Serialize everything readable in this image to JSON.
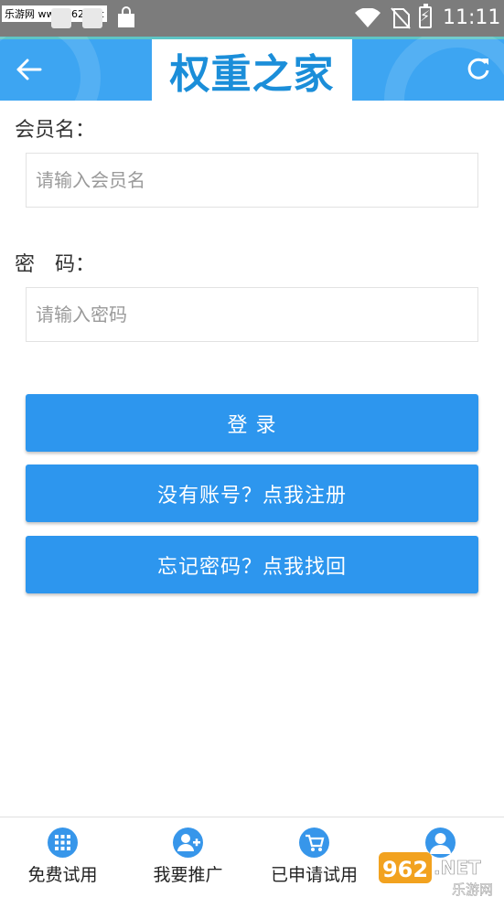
{
  "status_bar": {
    "watermark_text": "乐游网 www.962.net",
    "time": "11:11"
  },
  "header": {
    "logo_text": "权重之家",
    "back_icon": "arrow-left-icon",
    "refresh_icon": "refresh-icon"
  },
  "form": {
    "username_label": "会员名：",
    "username_placeholder": "请输入会员名",
    "username_value": "",
    "password_label": "密　码：",
    "password_placeholder": "请输入密码",
    "password_value": ""
  },
  "buttons": {
    "login": "登 录",
    "register": "没有账号？点我注册",
    "recover": "忘记密码？点我找回"
  },
  "tabs": [
    {
      "label": "免费试用",
      "icon": "grid-icon"
    },
    {
      "label": "我要推广",
      "icon": "add-user-icon"
    },
    {
      "label": "已申请试用",
      "icon": "cart-icon"
    },
    {
      "label": "",
      "icon": "user-icon"
    }
  ],
  "site_watermark": {
    "number": "962",
    "suffix": ".NET",
    "name": "乐游网"
  },
  "colors": {
    "accent": "#2d96ee",
    "header": "#3da5f2",
    "status_bar": "#7c7c7c"
  }
}
